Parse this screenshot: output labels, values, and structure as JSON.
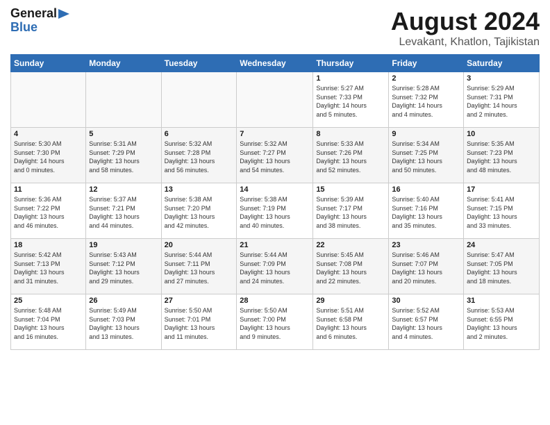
{
  "header": {
    "logo_general": "General",
    "logo_blue": "Blue",
    "title": "August 2024",
    "subtitle": "Levakant, Khatlon, Tajikistan"
  },
  "weekdays": [
    "Sunday",
    "Monday",
    "Tuesday",
    "Wednesday",
    "Thursday",
    "Friday",
    "Saturday"
  ],
  "weeks": [
    [
      {
        "day": "",
        "info": ""
      },
      {
        "day": "",
        "info": ""
      },
      {
        "day": "",
        "info": ""
      },
      {
        "day": "",
        "info": ""
      },
      {
        "day": "1",
        "info": "Sunrise: 5:27 AM\nSunset: 7:33 PM\nDaylight: 14 hours\nand 5 minutes."
      },
      {
        "day": "2",
        "info": "Sunrise: 5:28 AM\nSunset: 7:32 PM\nDaylight: 14 hours\nand 4 minutes."
      },
      {
        "day": "3",
        "info": "Sunrise: 5:29 AM\nSunset: 7:31 PM\nDaylight: 14 hours\nand 2 minutes."
      }
    ],
    [
      {
        "day": "4",
        "info": "Sunrise: 5:30 AM\nSunset: 7:30 PM\nDaylight: 14 hours\nand 0 minutes."
      },
      {
        "day": "5",
        "info": "Sunrise: 5:31 AM\nSunset: 7:29 PM\nDaylight: 13 hours\nand 58 minutes."
      },
      {
        "day": "6",
        "info": "Sunrise: 5:32 AM\nSunset: 7:28 PM\nDaylight: 13 hours\nand 56 minutes."
      },
      {
        "day": "7",
        "info": "Sunrise: 5:32 AM\nSunset: 7:27 PM\nDaylight: 13 hours\nand 54 minutes."
      },
      {
        "day": "8",
        "info": "Sunrise: 5:33 AM\nSunset: 7:26 PM\nDaylight: 13 hours\nand 52 minutes."
      },
      {
        "day": "9",
        "info": "Sunrise: 5:34 AM\nSunset: 7:25 PM\nDaylight: 13 hours\nand 50 minutes."
      },
      {
        "day": "10",
        "info": "Sunrise: 5:35 AM\nSunset: 7:23 PM\nDaylight: 13 hours\nand 48 minutes."
      }
    ],
    [
      {
        "day": "11",
        "info": "Sunrise: 5:36 AM\nSunset: 7:22 PM\nDaylight: 13 hours\nand 46 minutes."
      },
      {
        "day": "12",
        "info": "Sunrise: 5:37 AM\nSunset: 7:21 PM\nDaylight: 13 hours\nand 44 minutes."
      },
      {
        "day": "13",
        "info": "Sunrise: 5:38 AM\nSunset: 7:20 PM\nDaylight: 13 hours\nand 42 minutes."
      },
      {
        "day": "14",
        "info": "Sunrise: 5:38 AM\nSunset: 7:19 PM\nDaylight: 13 hours\nand 40 minutes."
      },
      {
        "day": "15",
        "info": "Sunrise: 5:39 AM\nSunset: 7:17 PM\nDaylight: 13 hours\nand 38 minutes."
      },
      {
        "day": "16",
        "info": "Sunrise: 5:40 AM\nSunset: 7:16 PM\nDaylight: 13 hours\nand 35 minutes."
      },
      {
        "day": "17",
        "info": "Sunrise: 5:41 AM\nSunset: 7:15 PM\nDaylight: 13 hours\nand 33 minutes."
      }
    ],
    [
      {
        "day": "18",
        "info": "Sunrise: 5:42 AM\nSunset: 7:13 PM\nDaylight: 13 hours\nand 31 minutes."
      },
      {
        "day": "19",
        "info": "Sunrise: 5:43 AM\nSunset: 7:12 PM\nDaylight: 13 hours\nand 29 minutes."
      },
      {
        "day": "20",
        "info": "Sunrise: 5:44 AM\nSunset: 7:11 PM\nDaylight: 13 hours\nand 27 minutes."
      },
      {
        "day": "21",
        "info": "Sunrise: 5:44 AM\nSunset: 7:09 PM\nDaylight: 13 hours\nand 24 minutes."
      },
      {
        "day": "22",
        "info": "Sunrise: 5:45 AM\nSunset: 7:08 PM\nDaylight: 13 hours\nand 22 minutes."
      },
      {
        "day": "23",
        "info": "Sunrise: 5:46 AM\nSunset: 7:07 PM\nDaylight: 13 hours\nand 20 minutes."
      },
      {
        "day": "24",
        "info": "Sunrise: 5:47 AM\nSunset: 7:05 PM\nDaylight: 13 hours\nand 18 minutes."
      }
    ],
    [
      {
        "day": "25",
        "info": "Sunrise: 5:48 AM\nSunset: 7:04 PM\nDaylight: 13 hours\nand 16 minutes."
      },
      {
        "day": "26",
        "info": "Sunrise: 5:49 AM\nSunset: 7:03 PM\nDaylight: 13 hours\nand 13 minutes."
      },
      {
        "day": "27",
        "info": "Sunrise: 5:50 AM\nSunset: 7:01 PM\nDaylight: 13 hours\nand 11 minutes."
      },
      {
        "day": "28",
        "info": "Sunrise: 5:50 AM\nSunset: 7:00 PM\nDaylight: 13 hours\nand 9 minutes."
      },
      {
        "day": "29",
        "info": "Sunrise: 5:51 AM\nSunset: 6:58 PM\nDaylight: 13 hours\nand 6 minutes."
      },
      {
        "day": "30",
        "info": "Sunrise: 5:52 AM\nSunset: 6:57 PM\nDaylight: 13 hours\nand 4 minutes."
      },
      {
        "day": "31",
        "info": "Sunrise: 5:53 AM\nSunset: 6:55 PM\nDaylight: 13 hours\nand 2 minutes."
      }
    ]
  ]
}
